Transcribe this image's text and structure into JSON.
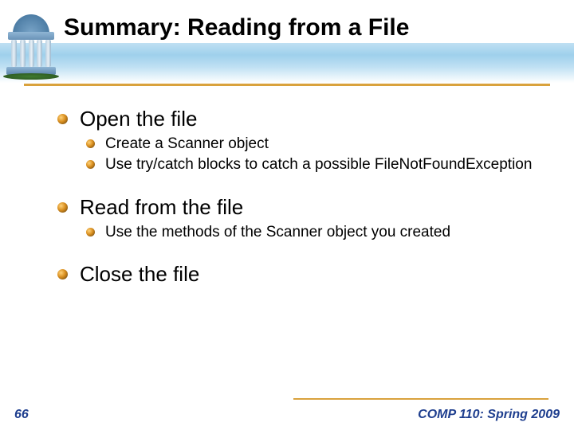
{
  "title": "Summary: Reading from a File",
  "bullets": {
    "b1": "Open the file",
    "b1_1": "Create a Scanner object",
    "b1_2": "Use try/catch blocks to catch a possible FileNotFoundException",
    "b2": "Read from the file",
    "b2_1": "Use the methods of the Scanner object you created",
    "b3": "Close the file"
  },
  "footer": {
    "page": "66",
    "course": "COMP 110: Spring 2009"
  }
}
